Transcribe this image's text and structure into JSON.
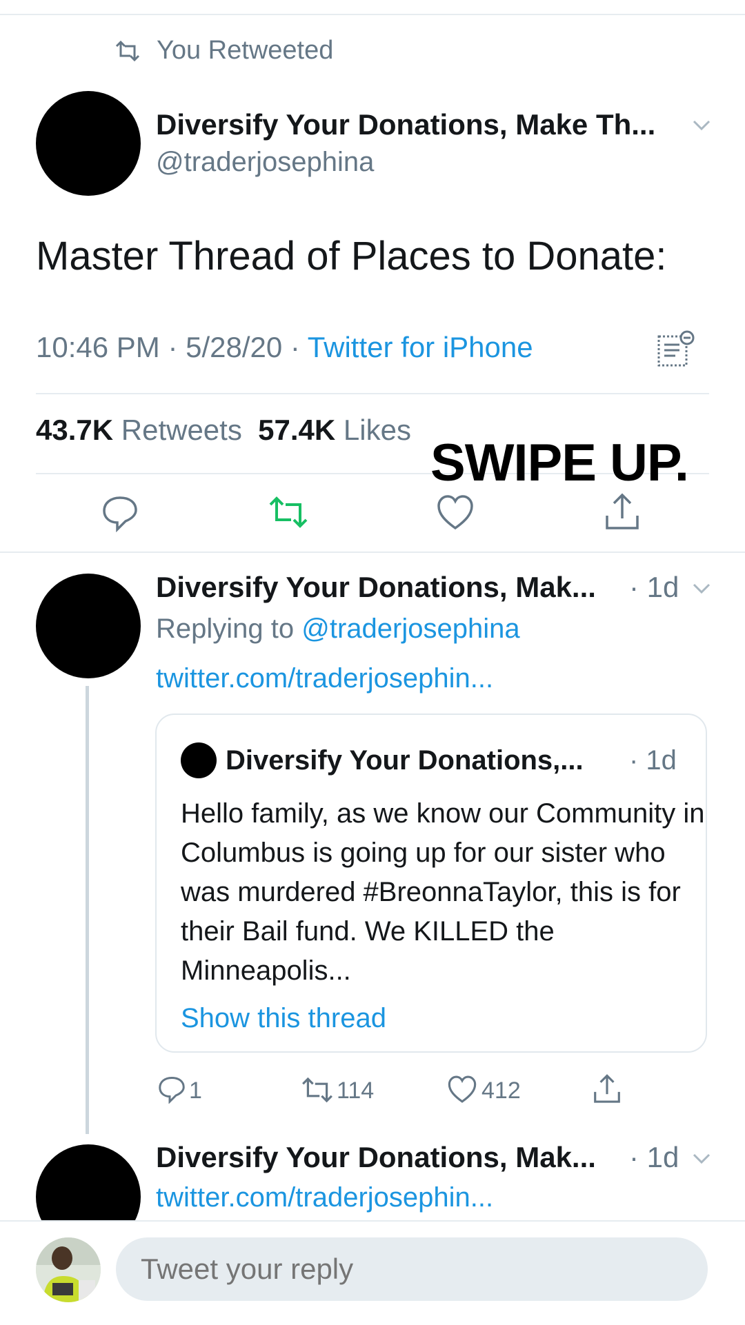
{
  "retweet_indicator": {
    "label": "You Retweeted"
  },
  "main_tweet": {
    "display_name": "Diversify Your Donations, Make Th...",
    "handle": "@traderjosephina",
    "text": "Master Thread of Places to Donate:",
    "time": "10:46 PM · 5/28/20 · ",
    "source": "Twitter for iPhone",
    "retweet_count": "43.7K",
    "retweet_label": "Retweets",
    "like_count": "57.4K",
    "like_label": "Likes"
  },
  "overlay": {
    "swipe_text": "SWIPE UP."
  },
  "reply1": {
    "display_name": "Diversify Your Donations, Mak...",
    "age": "· 1d",
    "replying_prefix": "Replying to ",
    "replying_handle": "@traderjosephina",
    "link": "twitter.com/traderjosephin...",
    "quote": {
      "display_name": "Diversify Your Donations,...",
      "age": "· 1d",
      "text": "Hello family, as we know our Community in Columbus is going up for our sister who was murdered #BreonnaTaylor, this is for their Bail fund. We KILLED the Minneapolis...",
      "show_thread": "Show this thread"
    },
    "reply_count": "1",
    "retweet_count": "114",
    "like_count": "412"
  },
  "reply2": {
    "display_name": "Diversify Your Donations, Mak...",
    "age": "· 1d",
    "link": "twitter.com/traderjosephin..."
  },
  "reply_composer": {
    "placeholder": "Tweet your reply"
  },
  "colors": {
    "retweet_active": "#17bf63",
    "link_blue": "#1b95e0",
    "secondary_grey": "#657786"
  },
  "icons": [
    "retweet-icon",
    "chevron-down-icon",
    "analytics-icon",
    "reply-icon",
    "like-icon",
    "share-icon"
  ]
}
